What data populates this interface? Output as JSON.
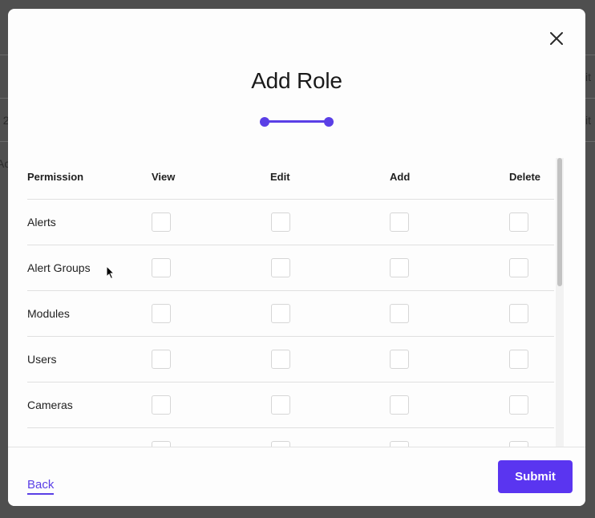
{
  "background": {
    "row_fragments_right": [
      "it",
      "it"
    ],
    "row_fragments_left": [
      "t 2",
      "Ac"
    ]
  },
  "modal": {
    "title": "Add Role",
    "close_icon": "close-icon",
    "accent_color": "#5a3fe6",
    "stepper": {
      "steps": 2,
      "current_step": 2
    },
    "table": {
      "headers": {
        "permission": "Permission",
        "view": "View",
        "edit": "Edit",
        "add": "Add",
        "delete": "Delete"
      },
      "rows": [
        {
          "label": "Alerts",
          "view": false,
          "edit": false,
          "add": false,
          "delete": false
        },
        {
          "label": "Alert Groups",
          "view": false,
          "edit": false,
          "add": false,
          "delete": false
        },
        {
          "label": "Modules",
          "view": false,
          "edit": false,
          "add": false,
          "delete": false
        },
        {
          "label": "Users",
          "view": false,
          "edit": false,
          "add": false,
          "delete": false
        },
        {
          "label": "Cameras",
          "view": false,
          "edit": false,
          "add": false,
          "delete": false
        },
        {
          "label": "",
          "view": false,
          "edit": false,
          "add": false,
          "delete": false
        }
      ]
    },
    "footer": {
      "back_label": "Back",
      "submit_label": "Submit"
    }
  }
}
